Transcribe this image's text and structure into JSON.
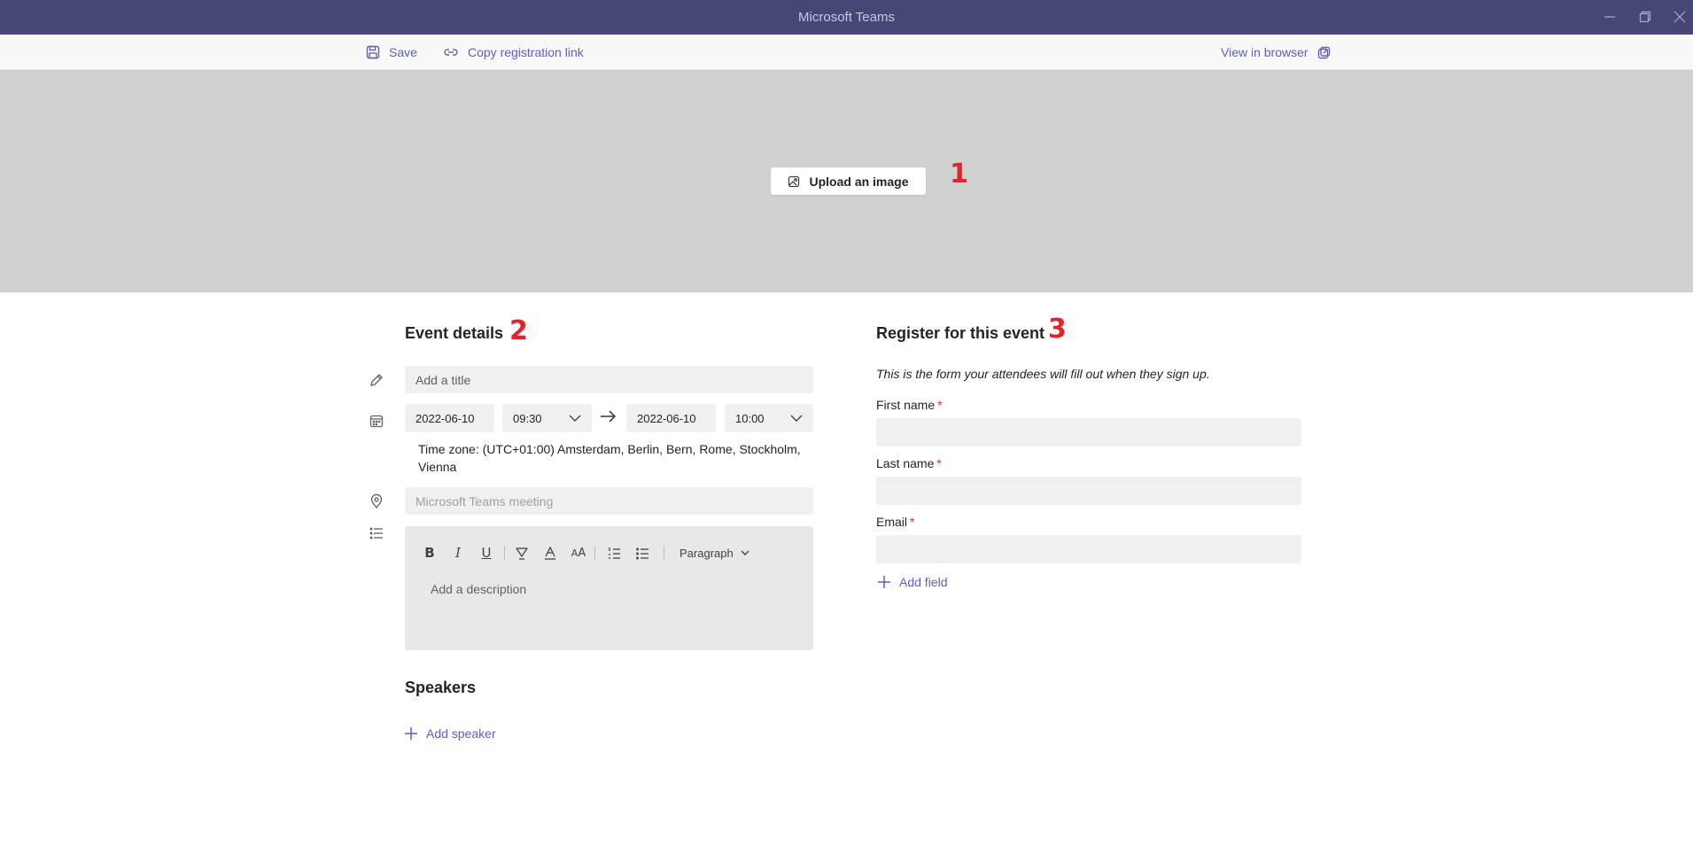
{
  "window": {
    "title": "Microsoft Teams"
  },
  "toolbar": {
    "save_label": "Save",
    "copy_link_label": "Copy registration link",
    "view_browser_label": "View in browser"
  },
  "banner": {
    "upload_label": "Upload an image",
    "annotation": "1"
  },
  "event_details": {
    "heading": "Event details",
    "annotation": "2",
    "title_placeholder": "Add a title",
    "start_date": "2022-06-10",
    "start_time": "09:30",
    "end_date": "2022-06-10",
    "end_time": "10:00",
    "timezone_line1": "Time zone: (UTC+01:00) Amsterdam, Berlin, Bern, Rome, Stockholm,",
    "timezone_line2": "Vienna",
    "location_placeholder": "Microsoft Teams meeting",
    "editor": {
      "paragraph_label": "Paragraph",
      "description_placeholder": "Add a description"
    }
  },
  "speakers": {
    "heading": "Speakers",
    "add_label": "Add speaker"
  },
  "registration": {
    "heading": "Register for this event",
    "annotation": "3",
    "subtitle": "This is the form your attendees will fill out when they sign up.",
    "fields": [
      {
        "label": "First name",
        "required": "*"
      },
      {
        "label": "Last name",
        "required": "*"
      },
      {
        "label": "Email",
        "required": "*"
      }
    ],
    "add_field_label": "Add field"
  },
  "colors": {
    "titlebar": "#464775",
    "accent": "#5b5fc7",
    "annotation": "#e3242b",
    "required": "#c4314b"
  },
  "icons": [
    "minimize-icon",
    "maximize-icon",
    "close-icon",
    "save-icon",
    "link-icon",
    "open-external-icon",
    "image-icon",
    "pencil-icon",
    "calendar-icon",
    "arrow-right-icon",
    "chevron-down-icon",
    "location-icon",
    "list-icon",
    "bold-icon",
    "italic-icon",
    "underline-icon",
    "highlight-icon",
    "font-color-icon",
    "font-size-icon",
    "numbered-list-icon",
    "bulleted-list-icon",
    "plus-icon"
  ]
}
